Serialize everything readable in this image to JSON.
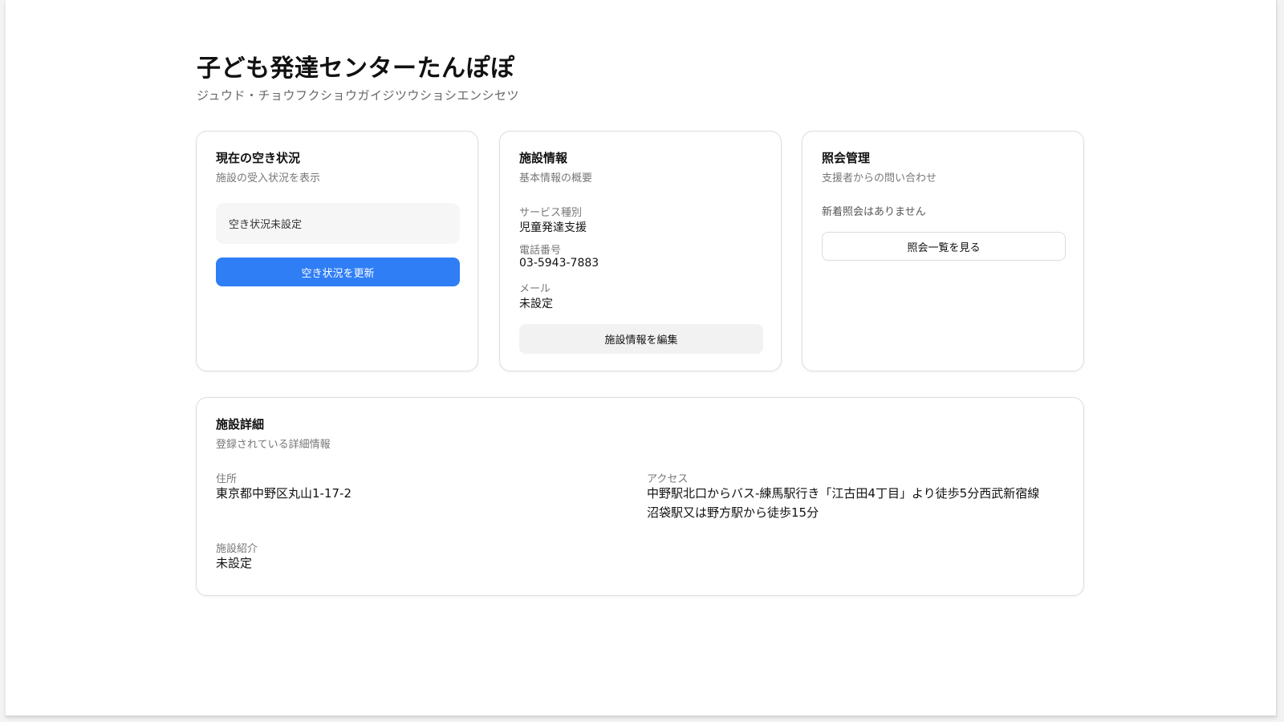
{
  "header": {
    "title": "子ども発達センターたんぽぽ",
    "subtitle": "ジュウド・チョウフクショウガイジツウショシエンシセツ"
  },
  "availability": {
    "title": "現在の空き状況",
    "description": "施設の受入状況を表示",
    "status": "空き状況未設定",
    "update_button": "空き状況を更新"
  },
  "facility_info": {
    "title": "施設情報",
    "description": "基本情報の概要",
    "fields": [
      {
        "label": "サービス種別",
        "value": "児童発達支援"
      },
      {
        "label": "電話番号",
        "value": "03-5943-7883"
      },
      {
        "label": "メール",
        "value": "未設定"
      }
    ],
    "edit_button": "施設情報を編集"
  },
  "inquiries": {
    "title": "照会管理",
    "description": "支援者からの問い合わせ",
    "empty_text": "新着照会はありません",
    "list_button": "照会一覧を見る"
  },
  "details": {
    "title": "施設詳細",
    "description": "登録されている詳細情報",
    "address_label": "住所",
    "address_value": "東京都中野区丸山1-17-2",
    "access_label": "アクセス",
    "access_value_line1": "中野駅北口からバス-練馬駅行き「江古田4丁目」より徒歩5分西武新宿線",
    "access_value_line2": "沼袋駅又は野方駅から徒歩15分",
    "intro_label": "施設紹介",
    "intro_value": "未設定"
  },
  "colors": {
    "primary": "#2f7ef6",
    "card_border": "#dedede",
    "muted_text": "#777777"
  }
}
